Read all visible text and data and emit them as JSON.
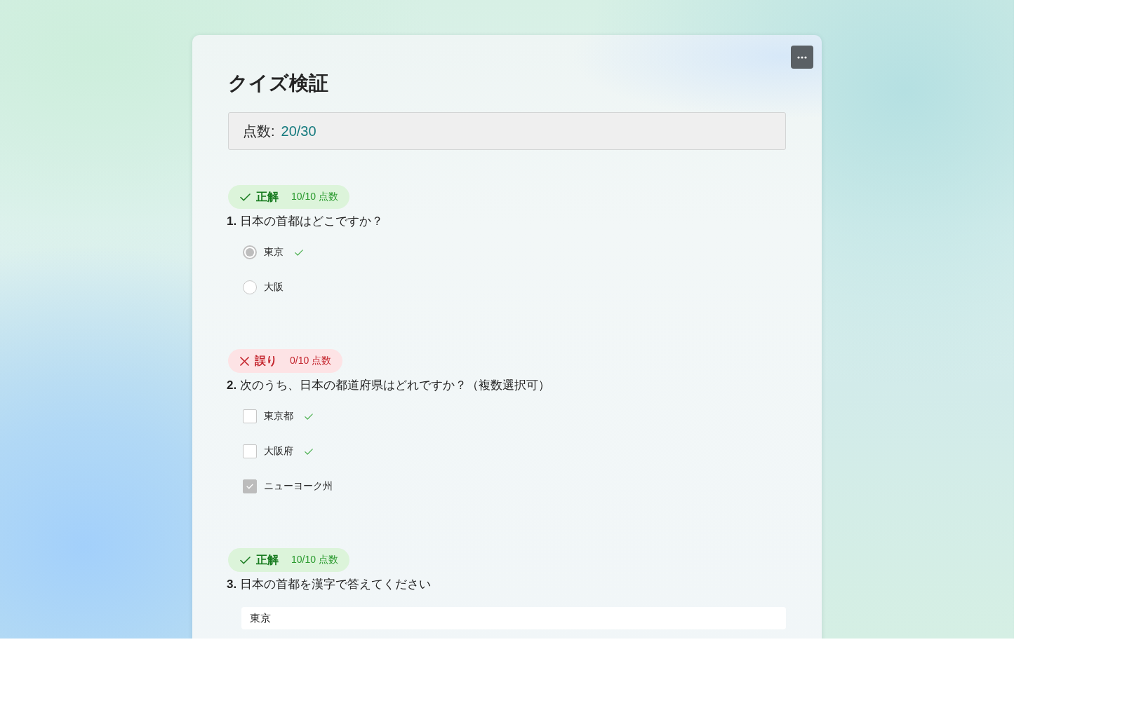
{
  "title": "クイズ検証",
  "score": {
    "label": "点数:",
    "value": "20/30"
  },
  "questions": [
    {
      "number": "1.",
      "text": "日本の首都はどこですか？",
      "correct": true,
      "verdict": "正解",
      "points": "10/10 点数",
      "kind": "single",
      "options": [
        {
          "label": "東京",
          "selected": true,
          "correct": true
        },
        {
          "label": "大阪",
          "selected": false,
          "correct": false
        }
      ]
    },
    {
      "number": "2.",
      "text": "次のうち、日本の都道府県はどれですか？（複数選択可）",
      "correct": false,
      "verdict": "誤り",
      "points": "0/10 点数",
      "kind": "multiple",
      "options": [
        {
          "label": "東京都",
          "checked": false,
          "correct": true
        },
        {
          "label": "大阪府",
          "checked": false,
          "correct": true
        },
        {
          "label": "ニューヨーク州",
          "checked": true,
          "correct": false
        }
      ]
    },
    {
      "number": "3.",
      "text": "日本の首都を漢字で答えてください",
      "correct": true,
      "verdict": "正解",
      "points": "10/10 点数",
      "kind": "text",
      "answer": "東京"
    }
  ]
}
